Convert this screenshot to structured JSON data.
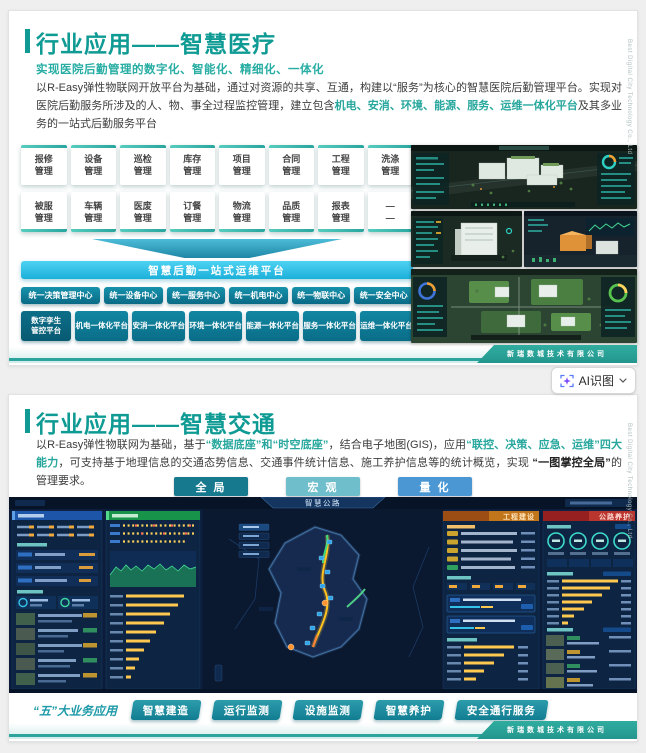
{
  "brand_side_text": "Best Digital City Technology Co., Ltd",
  "company_footer": "新瑞数城技术有限公司",
  "ai_tool": {
    "label": "AI识图"
  },
  "accents": {
    "title_teal": "#0f9b94",
    "highlight_teal": "#27a79d",
    "hub_cyan": "#2fc0e4",
    "button_teal": "#0f7f9a",
    "view_global": "#17798e",
    "view_macro": "#6fbecb",
    "view_quant": "#4a97d4",
    "footer_band": "#2aa49e",
    "ai_icon_purple": "#7b5cf0"
  },
  "slide1": {
    "title": "行业应用——智慧医疗",
    "subtitle": "实现医院后勤管理的数字化、智能化、精细化、一体化",
    "para": {
      "p1": "以R-Easy弹性物联网开放平台为基础，通过对资源的共享、互通，构建以“服务”为核心的智慧医院后勤管理平台。实现对医院后勤服务所涉及的人、物、事全过程监控管理，建立包含",
      "hl": "机电、安消、环境、能源、服务、运维一体化平台",
      "p2": "及其多业务的一站式后勤服务平台"
    },
    "modules": [
      {
        "l1": "报修",
        "l2": "管理"
      },
      {
        "l1": "设备",
        "l2": "管理"
      },
      {
        "l1": "巡检",
        "l2": "管理"
      },
      {
        "l1": "库存",
        "l2": "管理"
      },
      {
        "l1": "项目",
        "l2": "管理"
      },
      {
        "l1": "合同",
        "l2": "管理"
      },
      {
        "l1": "工程",
        "l2": "管理"
      },
      {
        "l1": "洗涤",
        "l2": "管理"
      },
      {
        "l1": "被服",
        "l2": "管理"
      },
      {
        "l1": "车辆",
        "l2": "管理"
      },
      {
        "l1": "医废",
        "l2": "管理"
      },
      {
        "l1": "订餐",
        "l2": "管理"
      },
      {
        "l1": "物流",
        "l2": "管理"
      },
      {
        "l1": "品质",
        "l2": "管理"
      },
      {
        "l1": "报表",
        "l2": "管理"
      },
      {
        "l1": "—",
        "l2": "—"
      }
    ],
    "hub_bar": "智慧后勤一站式运维平台",
    "centers": [
      "统一决策管理中心",
      "统一设备中心",
      "统一服务中心",
      "统一机电中心",
      "统一物联中心",
      "统一安全中心"
    ],
    "platforms": [
      {
        "l1": "数字孪生",
        "l2": "管控平台"
      },
      {
        "l1": "机电一体化平台"
      },
      {
        "l1": "安消一体化平台"
      },
      {
        "l1": "环境一体化平台"
      },
      {
        "l1": "能源一体化平台"
      },
      {
        "l1": "服务一体化平台"
      },
      {
        "l1": "运维一体化平台"
      }
    ]
  },
  "slide2": {
    "title": "行业应用——智慧交通",
    "para": {
      "p1": "以R-Easy弹性物联网为基础，基于",
      "hl1": "“数据底座”和“时空底座”",
      "p2": "，结合电子地图(GIS)，应用",
      "hl2": "“联控、决策、应急、运维”四大能力",
      "p3": "，可支持基于地理信息的交通态势信息、交通事件统计信息、施工养护信息等的统计概览，实现 ",
      "hl3": "“一图掌控全局”",
      "p4": "的管理要求。"
    },
    "views": [
      "全 局",
      "宏 观",
      "量 化"
    ],
    "dash": {
      "title": "智慧公路",
      "panel_construction": "工程建设",
      "panel_maintenance": "公路养护"
    },
    "biz_label": "“五”大业务应用",
    "biz": [
      "智慧建造",
      "运行监测",
      "设施监测",
      "智慧养护",
      "安全通行服务"
    ]
  }
}
